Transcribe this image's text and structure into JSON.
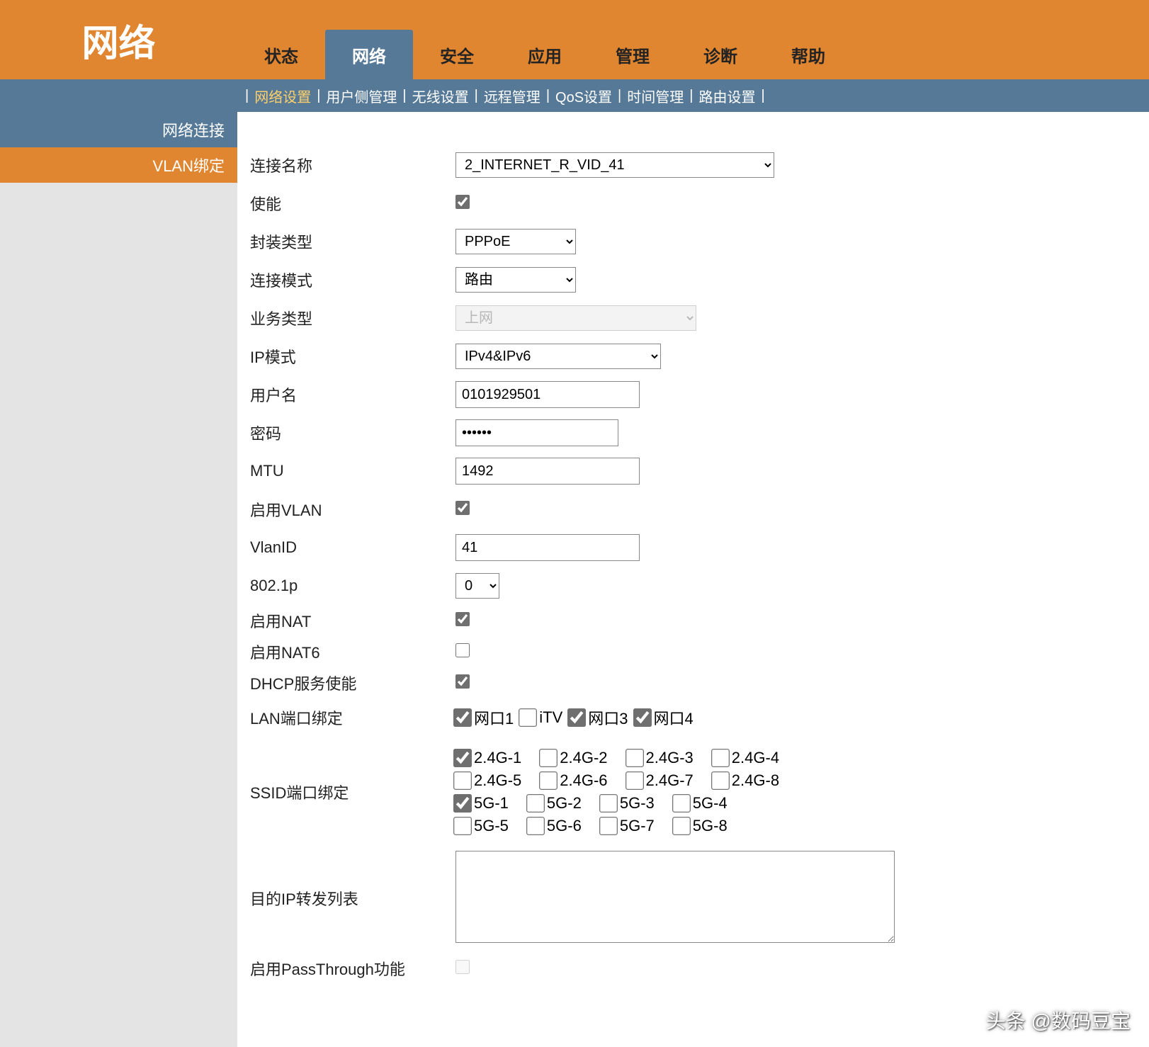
{
  "logo": "网络",
  "top_tabs": [
    "状态",
    "网络",
    "安全",
    "应用",
    "管理",
    "诊断",
    "帮助"
  ],
  "top_tabs_active": 1,
  "sub_nav": [
    "网络设置",
    "用户侧管理",
    "无线设置",
    "远程管理",
    "QoS设置",
    "时间管理",
    "路由设置"
  ],
  "sub_nav_active": 0,
  "sidebar": [
    {
      "label": "网络连接",
      "style": "blue"
    },
    {
      "label": "VLAN绑定",
      "style": "orange"
    }
  ],
  "form": {
    "conn_name": {
      "label": "连接名称",
      "value": "2_INTERNET_R_VID_41"
    },
    "enable": {
      "label": "使能",
      "checked": true
    },
    "encap": {
      "label": "封装类型",
      "value": "PPPoE"
    },
    "conn_mode": {
      "label": "连接模式",
      "value": "路由"
    },
    "service_type": {
      "label": "业务类型",
      "value": "上网"
    },
    "ip_mode": {
      "label": "IP模式",
      "value": "IPv4&IPv6"
    },
    "username": {
      "label": "用户名",
      "value": "0101929501"
    },
    "password": {
      "label": "密码",
      "value": "••••••"
    },
    "mtu": {
      "label": "MTU",
      "value": "1492"
    },
    "vlan_enable": {
      "label": "启用VLAN",
      "checked": true
    },
    "vlan_id": {
      "label": "VlanID",
      "value": "41"
    },
    "p8021": {
      "label": "802.1p",
      "value": "0"
    },
    "nat": {
      "label": "启用NAT",
      "checked": true
    },
    "nat6": {
      "label": "启用NAT6",
      "checked": false
    },
    "dhcp": {
      "label": "DHCP服务使能",
      "checked": true
    },
    "lan_bind": {
      "label": "LAN端口绑定",
      "items": [
        {
          "label": "网口1",
          "checked": true
        },
        {
          "label": "iTV",
          "checked": false
        },
        {
          "label": "网口3",
          "checked": true
        },
        {
          "label": "网口4",
          "checked": true
        }
      ]
    },
    "ssid_bind": {
      "label": "SSID端口绑定",
      "rows": [
        [
          {
            "label": "2.4G-1",
            "checked": true
          },
          {
            "label": "2.4G-2",
            "checked": false
          },
          {
            "label": "2.4G-3",
            "checked": false
          },
          {
            "label": "2.4G-4",
            "checked": false
          }
        ],
        [
          {
            "label": "2.4G-5",
            "checked": false
          },
          {
            "label": "2.4G-6",
            "checked": false
          },
          {
            "label": "2.4G-7",
            "checked": false
          },
          {
            "label": "2.4G-8",
            "checked": false
          }
        ],
        [
          {
            "label": "5G-1",
            "checked": true
          },
          {
            "label": "5G-2",
            "checked": false
          },
          {
            "label": "5G-3",
            "checked": false
          },
          {
            "label": "5G-4",
            "checked": false
          }
        ],
        [
          {
            "label": "5G-5",
            "checked": false
          },
          {
            "label": "5G-6",
            "checked": false
          },
          {
            "label": "5G-7",
            "checked": false
          },
          {
            "label": "5G-8",
            "checked": false
          }
        ]
      ]
    },
    "dest_ip": {
      "label": "目的IP转发列表",
      "value": ""
    },
    "passthrough": {
      "label": "启用PassThrough功能",
      "checked": false
    }
  },
  "watermark": "头条 @数码豆宝"
}
